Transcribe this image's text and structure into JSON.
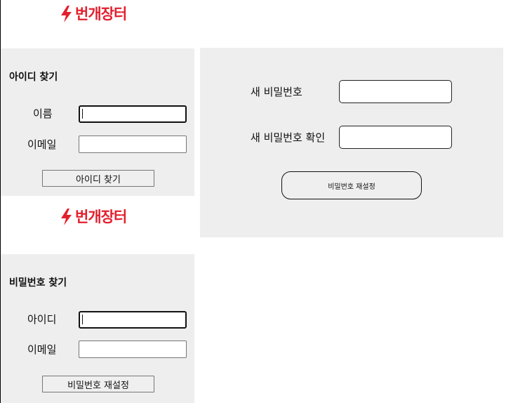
{
  "brand": {
    "name": "번개장터",
    "accent_color": "#e3202e",
    "icon": "lightning-bolt-icon"
  },
  "find_id": {
    "title": "아이디 찾기",
    "name_label": "이름",
    "name_value": "",
    "email_label": "이메일",
    "email_value": "",
    "submit_label": "아이디 찾기"
  },
  "find_password": {
    "title": "비밀번호 찾기",
    "id_label": "아이디",
    "id_value": "",
    "email_label": "이메일",
    "email_value": "",
    "submit_label": "비밀번호 재설정"
  },
  "reset_password": {
    "new_password_label": "새 비밀번호",
    "new_password_value": "",
    "confirm_label": "새 비밀번호 확인",
    "confirm_value": "",
    "submit_label": "비밀번호 재설정"
  }
}
